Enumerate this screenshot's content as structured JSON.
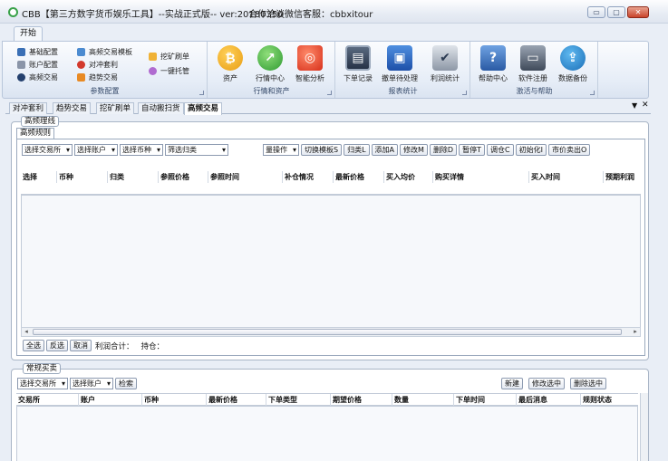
{
  "window": {
    "title": "CBB【第三方数字货币娱乐工具】--实战正式版-- ver:20180350",
    "contact": "合作洽谈微信客服：cbbxitour",
    "min": "▭",
    "max": "▢",
    "close": "✕"
  },
  "ribbon_tab": "开始",
  "groups": {
    "params": {
      "label": "参数配置",
      "items": [
        "基础配置",
        "账户配置",
        "高频交易",
        "高频交易模板",
        "对冲套利",
        "趋势交易",
        "挖矿刷单",
        "一键托管"
      ]
    },
    "market": {
      "label": "行情和资产",
      "items": [
        "资产",
        "行情中心",
        "智能分析"
      ]
    },
    "report": {
      "label": "报表统计",
      "items": [
        "下单记录",
        "撤单待处理",
        "利润统计"
      ]
    },
    "help": {
      "label": "激活与帮助",
      "items": [
        "帮助中心",
        "软件注册",
        "数据备份"
      ]
    }
  },
  "doc_tabs": [
    "对冲套利",
    "趋势交易",
    "挖矿刷单",
    "自动搬扫货",
    "高频交易"
  ],
  "hf": {
    "legend": "高频理线",
    "subtab": "高频规则",
    "filters": [
      "选择交易所",
      "选择账户",
      "选择币种",
      "筛选归类"
    ],
    "batch": "量操作",
    "buttons": [
      "切换模板S",
      "归类L",
      "添加A",
      "修改M",
      "删除D",
      "暂停T",
      "调仓C",
      "初始化I",
      "市价卖出O"
    ],
    "columns": [
      "选择",
      "币种",
      "归类",
      "参照价格",
      "参照时间",
      "补仓情况",
      "最新价格",
      "买入均价",
      "购买详情",
      "买入时间",
      "预期利润"
    ],
    "footer_buttons": [
      "全选",
      "反选",
      "取消"
    ],
    "profit_label": "利润合计：",
    "position_label": "持仓："
  },
  "regular": {
    "legend": "常规买卖",
    "filters": [
      "选择交易所",
      "选择账户"
    ],
    "search": "检索",
    "actions": [
      "新建",
      "修改选中",
      "删除选中"
    ],
    "columns": [
      "交易所",
      "账户",
      "币种",
      "最新价格",
      "下单类型",
      "期望价格",
      "数量",
      "下单时间",
      "最后消息",
      "规则状态"
    ]
  },
  "colors": {
    "accent": "#2b6fc4",
    "ribbon_border": "#b8c6da"
  }
}
